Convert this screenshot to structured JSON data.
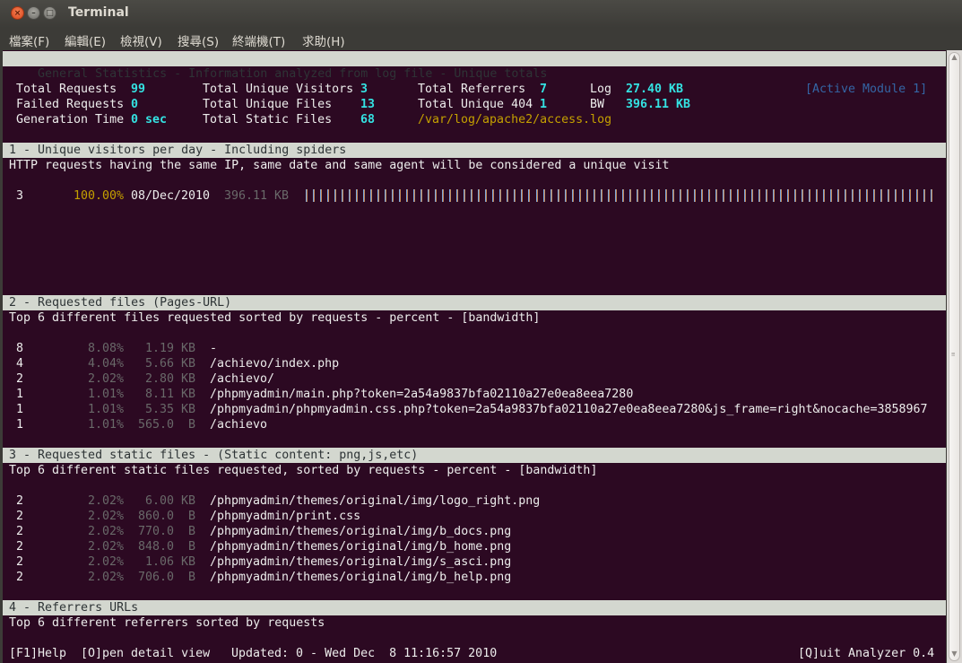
{
  "window": {
    "title": "Terminal",
    "buttons": {
      "close": "×",
      "minimize": "–",
      "maximize": "□"
    }
  },
  "menu": [
    "檔案(F)",
    "編輯(E)",
    "檢視(V)",
    "搜尋(S)",
    "終端機(T)",
    "求助(H)"
  ],
  "general": {
    "header": "General Statistics - Information analyzed from log file - Unique totals",
    "active_module": "[Active Module 1]",
    "stats": {
      "total_requests_label": "Total Requests",
      "total_requests": "99",
      "failed_requests_label": "Failed Requests",
      "failed_requests": "0",
      "generation_time_label": "Generation Time",
      "generation_time": "0 sec",
      "unique_visitors_label": "Total Unique Visitors",
      "unique_visitors": "3",
      "unique_files_label": "Total Unique Files",
      "unique_files": "13",
      "static_files_label": "Total Static Files",
      "static_files": "68",
      "referrers_label": "Total Referrers",
      "referrers": "7",
      "unique_404_label": "Total Unique 404",
      "unique_404": "1",
      "log_path": "/var/log/apache2/access.log",
      "log_label": "Log",
      "log_size": "27.40 KB",
      "bw_label": "BW",
      "bw": "396.11 KB"
    }
  },
  "section1": {
    "header": "1 - Unique visitors per day - Including spiders",
    "description": "HTTP requests having the same IP, same date and same agent will be considered a unique visit",
    "rows": [
      {
        "hits": "3",
        "percent": "100.00%",
        "date": "08/Dec/2010",
        "bandwidth": "396.11 KB",
        "bar_fraction": 1.0
      }
    ]
  },
  "section2": {
    "header": "2 - Requested files (Pages-URL)",
    "description": "Top 6 different files requested sorted by requests - percent - [bandwidth]",
    "rows": [
      {
        "hits": "8",
        "percent": "8.08%",
        "bandwidth": "1.19 KB",
        "path": "-"
      },
      {
        "hits": "4",
        "percent": "4.04%",
        "bandwidth": "5.66 KB",
        "path": "/achievo/index.php"
      },
      {
        "hits": "2",
        "percent": "2.02%",
        "bandwidth": "2.80 KB",
        "path": "/achievo/"
      },
      {
        "hits": "1",
        "percent": "1.01%",
        "bandwidth": "8.11 KB",
        "path": "/phpmyadmin/main.php?token=2a54a9837bfa02110a27e0ea8eea7280"
      },
      {
        "hits": "1",
        "percent": "1.01%",
        "bandwidth": "5.35 KB",
        "path": "/phpmyadmin/phpmyadmin.css.php?token=2a54a9837bfa02110a27e0ea8eea7280&js_frame=right&nocache=3858967"
      },
      {
        "hits": "1",
        "percent": "1.01%",
        "bandwidth": "565.0  B",
        "path": "/achievo"
      }
    ]
  },
  "section3": {
    "header": "3 - Requested static files - (Static content: png,js,etc)",
    "description": "Top 6 different static files requested, sorted by requests - percent - [bandwidth]",
    "rows": [
      {
        "hits": "2",
        "percent": "2.02%",
        "bandwidth": "6.00 KB",
        "path": "/phpmyadmin/themes/original/img/logo_right.png"
      },
      {
        "hits": "2",
        "percent": "2.02%",
        "bandwidth": "860.0  B",
        "path": "/phpmyadmin/print.css"
      },
      {
        "hits": "2",
        "percent": "2.02%",
        "bandwidth": "770.0  B",
        "path": "/phpmyadmin/themes/original/img/b_docs.png"
      },
      {
        "hits": "2",
        "percent": "2.02%",
        "bandwidth": "848.0  B",
        "path": "/phpmyadmin/themes/original/img/b_home.png"
      },
      {
        "hits": "2",
        "percent": "2.02%",
        "bandwidth": "1.06 KB",
        "path": "/phpmyadmin/themes/original/img/s_asci.png"
      },
      {
        "hits": "2",
        "percent": "2.02%",
        "bandwidth": "706.0  B",
        "path": "/phpmyadmin/themes/original/img/b_help.png"
      }
    ]
  },
  "section4": {
    "header": "4 - Referrers URLs",
    "description": "Top 6 different referrers sorted by requests"
  },
  "footer": {
    "help": "[F1]Help",
    "open_detail": "[O]pen detail view",
    "updated": "Updated: 0 - Wed Dec  8 11:16:57 2010",
    "quit": "[Q]uit Analyzer 0.4"
  }
}
